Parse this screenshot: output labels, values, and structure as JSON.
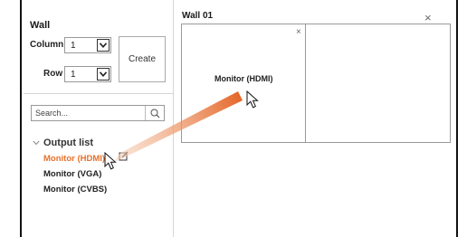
{
  "left": {
    "title": "Wall",
    "column_label": "Column",
    "column_value": "1",
    "row_label": "Row",
    "row_value": "1",
    "create_label": "Create",
    "search_placeholder": "Search...",
    "output_list_label": "Output list",
    "outputs": [
      {
        "label": "Monitor (HDMI)",
        "state": "selected"
      },
      {
        "label": "Monitor (VGA)",
        "state": "normal"
      },
      {
        "label": "Monitor (CVBS)",
        "state": "normal"
      }
    ]
  },
  "wall": {
    "title": "Wall 01",
    "close_glyph": "×",
    "cells": [
      {
        "label": "Monitor (HDMI)",
        "close_glyph": "×"
      },
      {
        "label": "",
        "close_glyph": ""
      }
    ]
  },
  "icons": {
    "search": "search-icon",
    "chevron_down": "chevron-down-icon",
    "chevron_collapse": "chevron-down-icon",
    "edit": "edit-icon",
    "cursor": "mouse-cursor-icon"
  },
  "colors": {
    "accent": "#e8702a",
    "drag_arrow_start": "#f7d4bd",
    "drag_arrow_end": "#e35f1e"
  }
}
